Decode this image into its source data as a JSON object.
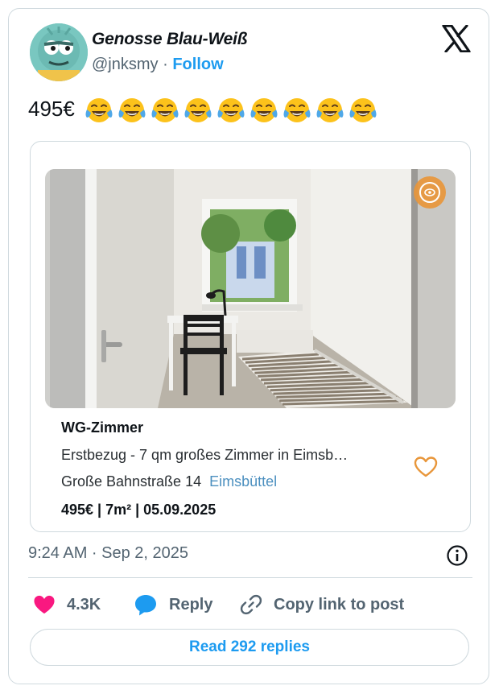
{
  "author": {
    "display_name": "Genosse Blau-Weiß",
    "handle": "@jnksmy",
    "separator": "·",
    "follow_label": "Follow"
  },
  "tweet": {
    "text": "495€",
    "emoji_name": "face-with-tears-of-joy",
    "emoji_count": 9
  },
  "listing": {
    "title": "WG-Zimmer",
    "description": "Erstbezug - 7 qm großes Zimmer in Eimsb…",
    "street": "Große Bahnstraße 14",
    "district": "Eimsbüttel",
    "meta": "495€ | 7m² | 05.09.2025",
    "badge_icon": "eye-in-circle-icon",
    "favorite_icon": "heart-outline-icon"
  },
  "footer": {
    "timestamp": "9:24 AM · Sep 2, 2025",
    "likes_count": "4.3K",
    "reply_label": "Reply",
    "copy_link_label": "Copy link to post",
    "read_replies_label": "Read 292 replies"
  },
  "colors": {
    "link_blue": "#1d9bf0",
    "like_pink": "#f91880",
    "muted_gray": "#536471",
    "border": "#cfd9de",
    "favorite_orange": "#e8963a"
  }
}
